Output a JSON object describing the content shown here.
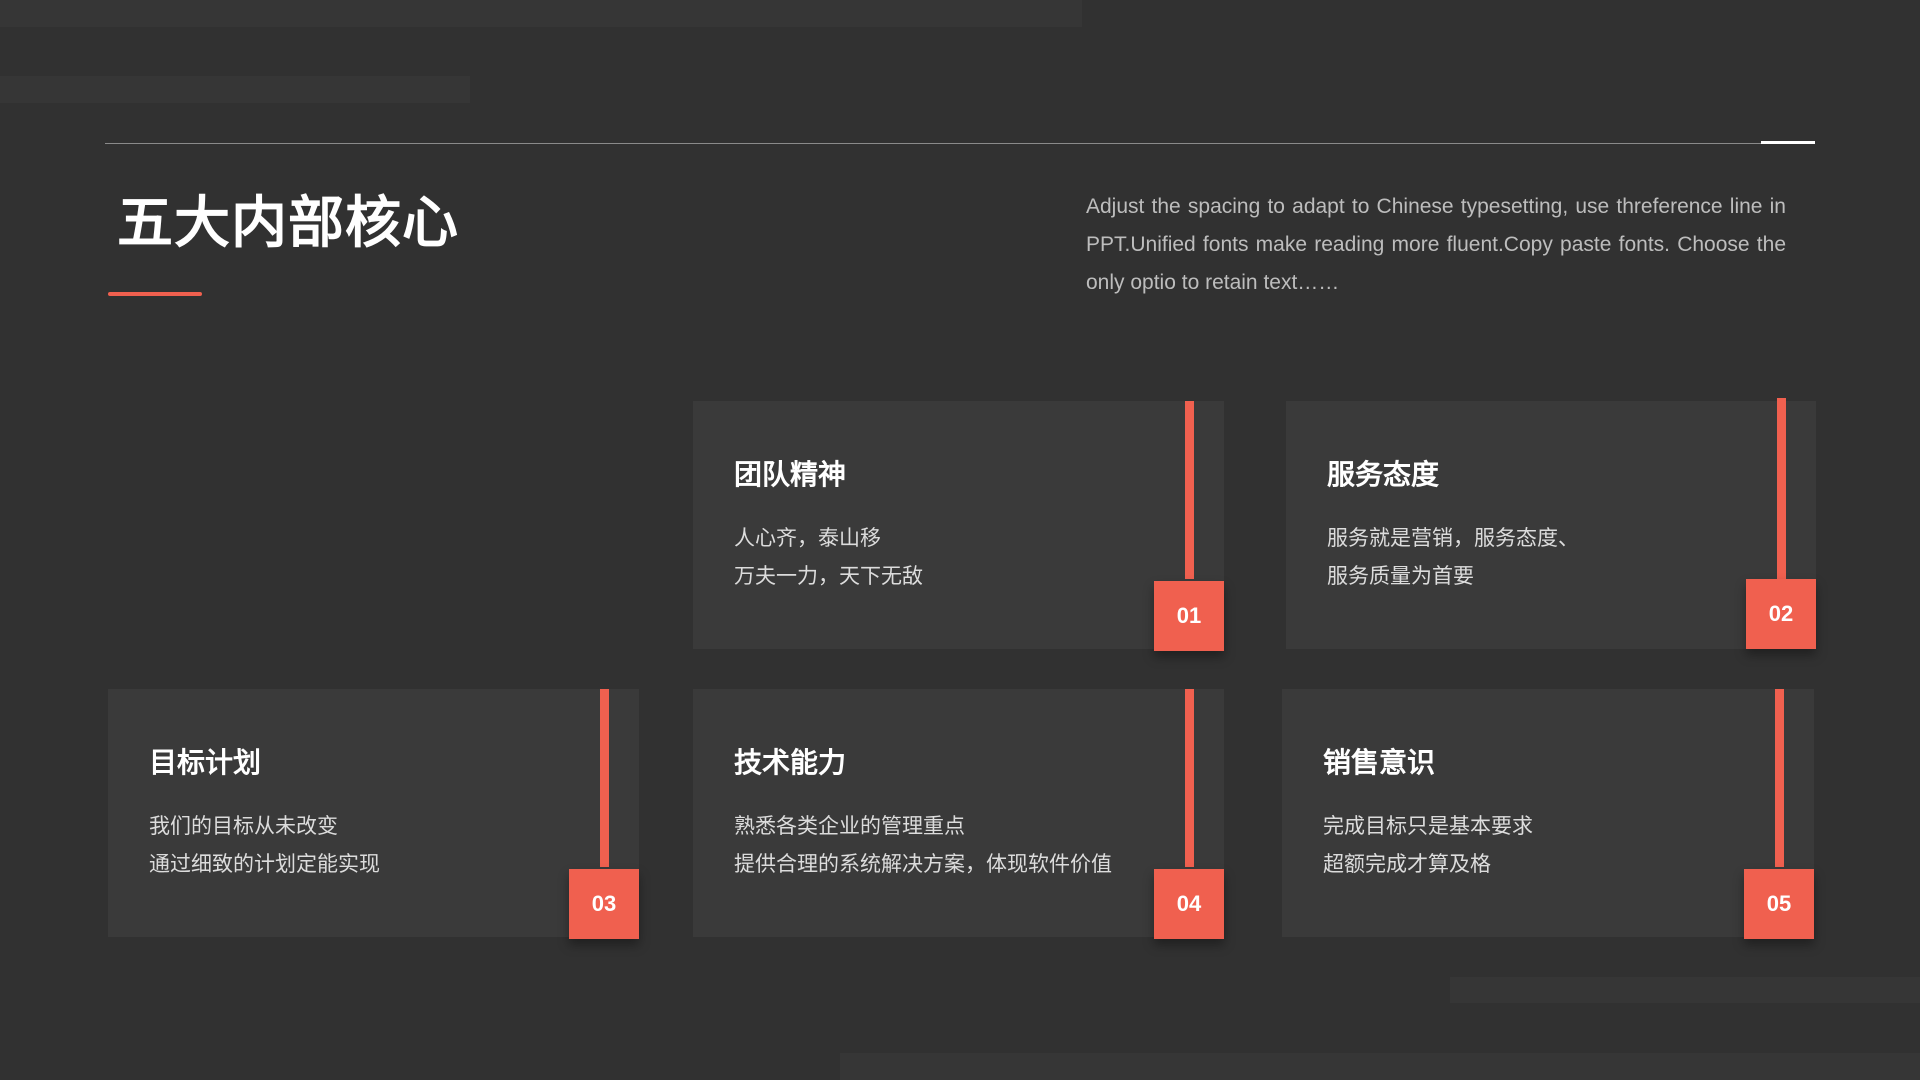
{
  "slide": {
    "title": "五大内部核心",
    "description": "Adjust the spacing to adapt to Chinese typesetting, use threference line in PPT.Unified fonts make reading more fluent.Copy paste fonts. Choose the only optio to retain text……",
    "accent_color": "#f0604f",
    "background_color": "#313131"
  },
  "cards": [
    {
      "number": "01",
      "title": "团队精神",
      "line1": "人心齐，泰山移",
      "line2": "万夫一力，天下无敌"
    },
    {
      "number": "02",
      "title": "服务态度",
      "line1": "服务就是营销，服务态度、",
      "line2": "服务质量为首要"
    },
    {
      "number": "03",
      "title": "目标计划",
      "line1": "我们的目标从未改变",
      "line2": "通过细致的计划定能实现"
    },
    {
      "number": "04",
      "title": "技术能力",
      "line1": "熟悉各类企业的管理重点",
      "line2": "提供合理的系统解决方案，体现软件价值"
    },
    {
      "number": "05",
      "title": "销售意识",
      "line1": "完成目标只是基本要求",
      "line2": "超额完成才算及格"
    }
  ]
}
